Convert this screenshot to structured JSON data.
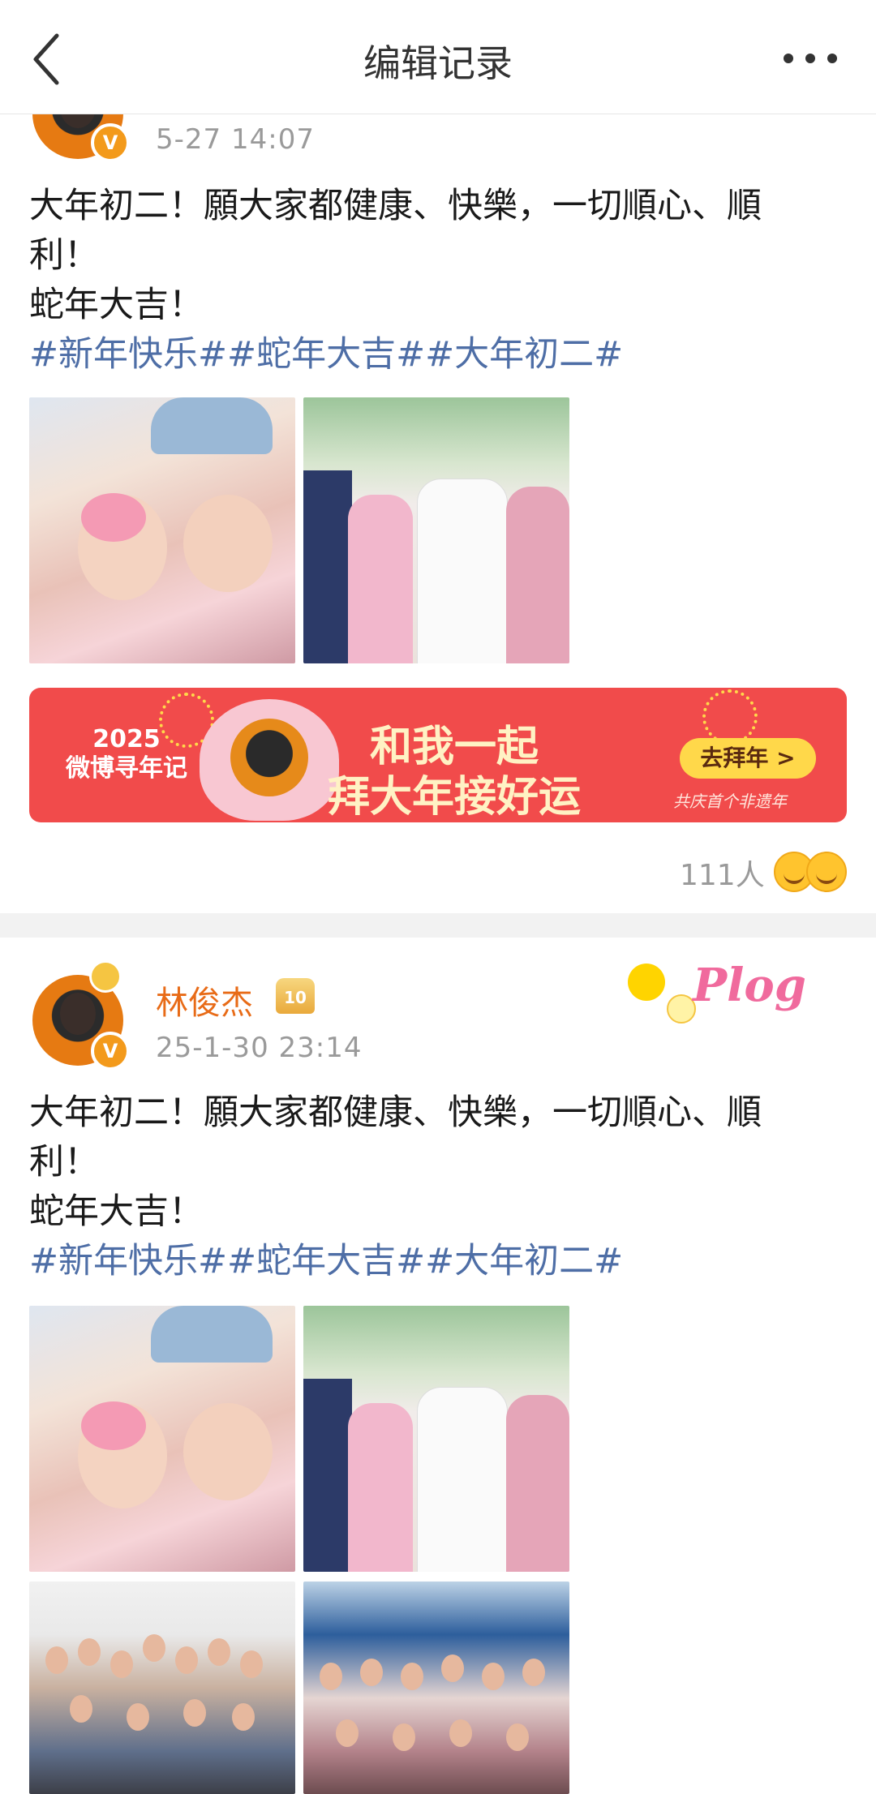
{
  "header": {
    "back_icon": "chevron-left-icon",
    "title": "编辑记录",
    "more_icon": "ellipsis-icon"
  },
  "posts": [
    {
      "time": "5-27 14:07",
      "verified_badge": "V",
      "text_lines": [
        "大年初二！願大家都健康、快樂，一切順心、順",
        "利！",
        "蛇年大吉！"
      ],
      "tags": "#新年快乐##蛇年大吉##大年初二#",
      "photos": [
        "family-babies-photo",
        "family-group-photo"
      ],
      "banner": {
        "year_line1": "2025",
        "year_line2": "微博寻年记",
        "title_line1": "和我一起",
        "title_line2": "拜大年接好运",
        "cta": "去拜年 >",
        "sub": "共庆首个非遗年"
      },
      "reactions": {
        "count": "111人"
      }
    },
    {
      "username": "林俊杰",
      "level_badge": "10",
      "plog_label": "Plog",
      "time": "25-1-30 23:14",
      "verified_badge": "V",
      "text_lines": [
        "大年初二！願大家都健康、快樂，一切順心、順",
        "利！",
        "蛇年大吉！"
      ],
      "tags": "#新年快乐##蛇年大吉##大年初二#",
      "photos": [
        "family-babies-photo",
        "family-group-photo",
        "large-family-photo",
        "aquarium-family-photo"
      ]
    }
  ],
  "colors": {
    "username": "#e86b17",
    "tag": "#4e6ea6",
    "banner_bg": "#f14b4b",
    "cta_bg": "#ffd84a"
  }
}
